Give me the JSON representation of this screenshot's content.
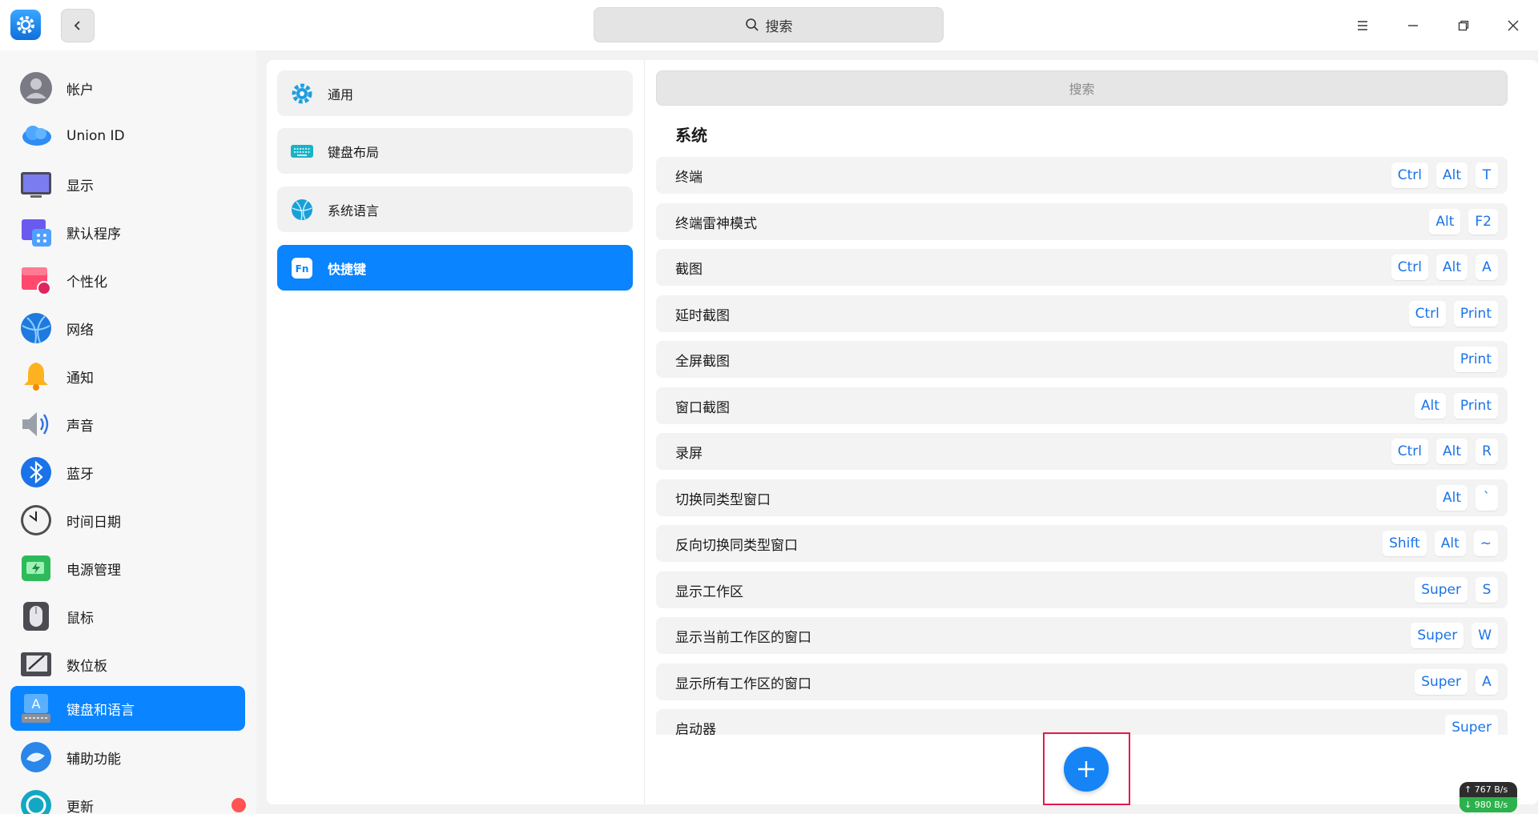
{
  "titlebar": {
    "app_icon": "gear-icon",
    "back_icon": "chevron-left-icon",
    "search_placeholder": "搜索",
    "menu_icon": "hamburger-icon",
    "minimize_icon": "minimize-icon",
    "maximize_icon": "maximize-icon",
    "close_icon": "close-icon"
  },
  "sidebar": {
    "items": [
      {
        "label": "帐户",
        "icon": "account-icon"
      },
      {
        "label": "Union ID",
        "icon": "cloud-icon"
      },
      {
        "label": "显示",
        "icon": "display-icon"
      },
      {
        "label": "默认程序",
        "icon": "default-apps-icon"
      },
      {
        "label": "个性化",
        "icon": "personalization-icon"
      },
      {
        "label": "网络",
        "icon": "network-icon"
      },
      {
        "label": "通知",
        "icon": "bell-icon"
      },
      {
        "label": "声音",
        "icon": "speaker-icon"
      },
      {
        "label": "蓝牙",
        "icon": "bluetooth-icon"
      },
      {
        "label": "时间日期",
        "icon": "clock-icon"
      },
      {
        "label": "电源管理",
        "icon": "battery-icon"
      },
      {
        "label": "鼠标",
        "icon": "mouse-icon"
      },
      {
        "label": "数位板",
        "icon": "tablet-icon"
      },
      {
        "label": "键盘和语言",
        "icon": "keyboard-language-icon",
        "active": true
      },
      {
        "label": "辅助功能",
        "icon": "accessibility-icon"
      },
      {
        "label": "更新",
        "icon": "update-icon"
      }
    ]
  },
  "subnav": {
    "items": [
      {
        "label": "通用",
        "icon": "gear-icon"
      },
      {
        "label": "键盘布局",
        "icon": "keyboard-icon"
      },
      {
        "label": "系统语言",
        "icon": "globe-icon"
      },
      {
        "label": "快捷键",
        "icon": "fn-key-icon",
        "active": true
      }
    ]
  },
  "shortcuts": {
    "search_placeholder": "搜索",
    "section_title": "系统",
    "rows": [
      {
        "name": "终端",
        "keys": [
          "Ctrl",
          "Alt",
          "T"
        ]
      },
      {
        "name": "终端雷神模式",
        "keys": [
          "Alt",
          "F2"
        ]
      },
      {
        "name": "截图",
        "keys": [
          "Ctrl",
          "Alt",
          "A"
        ]
      },
      {
        "name": "延时截图",
        "keys": [
          "Ctrl",
          "Print"
        ]
      },
      {
        "name": "全屏截图",
        "keys": [
          "Print"
        ]
      },
      {
        "name": "窗口截图",
        "keys": [
          "Alt",
          "Print"
        ]
      },
      {
        "name": "录屏",
        "keys": [
          "Ctrl",
          "Alt",
          "R"
        ]
      },
      {
        "name": "切换同类型窗口",
        "keys": [
          "Alt",
          "`"
        ]
      },
      {
        "name": "反向切换同类型窗口",
        "keys": [
          "Shift",
          "Alt",
          "~"
        ]
      },
      {
        "name": "显示工作区",
        "keys": [
          "Super",
          "S"
        ]
      },
      {
        "name": "显示当前工作区的窗口",
        "keys": [
          "Super",
          "W"
        ]
      },
      {
        "name": "显示所有工作区的窗口",
        "keys": [
          "Super",
          "A"
        ]
      },
      {
        "name": "启动器",
        "keys": [
          "Super"
        ]
      }
    ]
  },
  "add_button": {
    "icon": "plus-icon"
  },
  "netspeed": {
    "up": "↑ 767 B/s",
    "down": "↓ 980 B/s"
  },
  "colors": {
    "accent": "#0a84ff",
    "key_text": "#1a73e8",
    "highlight": "#e6194b"
  }
}
